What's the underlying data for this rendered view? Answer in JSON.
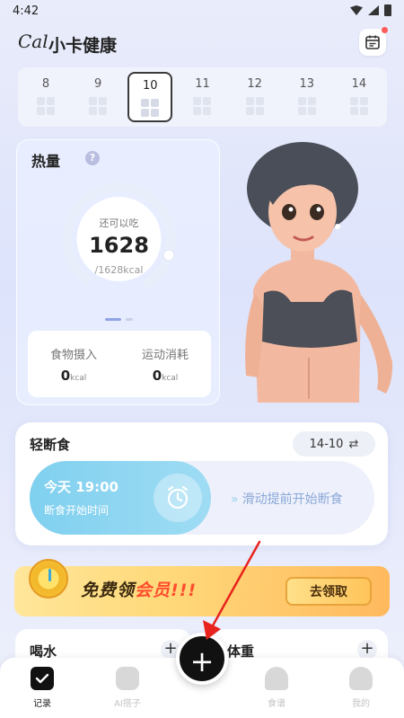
{
  "status_bar": {
    "time": "4:42"
  },
  "header": {
    "logo_text": "Cal",
    "title": "小卡健康"
  },
  "dates": [
    {
      "label": "8",
      "active": false
    },
    {
      "label": "9",
      "active": false
    },
    {
      "label": "10",
      "active": true
    },
    {
      "label": "11",
      "active": false
    },
    {
      "label": "12",
      "active": false
    },
    {
      "label": "13",
      "active": false
    },
    {
      "label": "14",
      "active": false
    }
  ],
  "calorie": {
    "title": "热量",
    "help": "?",
    "remaining_label": "还可以吃",
    "remaining_value": "1628",
    "target": "/1628kcal",
    "progress": 0,
    "food_label": "食物摄入",
    "food_value": "0",
    "exercise_label": "运动消耗",
    "exercise_value": "0",
    "unit": "kcal"
  },
  "fasting": {
    "title": "轻断食",
    "plan": "14-10",
    "time": "今天 19:00",
    "sub": "断食开始时间",
    "hint": "滑动提前开始断食"
  },
  "vip": {
    "text_1": "免费领",
    "text_2": "会员",
    "text_3": "!!!",
    "button": "去领取"
  },
  "water": {
    "title": "喝水",
    "plus": "+"
  },
  "weight": {
    "title": "体重",
    "plus": "+"
  },
  "tabs": [
    {
      "label": "记录",
      "active": true
    },
    {
      "label": "AI搭子",
      "active": false
    },
    {
      "label": "食谱",
      "active": false
    },
    {
      "label": "我的",
      "active": false
    }
  ],
  "fab": "+",
  "colors": {
    "accent": "#7fd0ef",
    "vip_red": "#ff4d2e",
    "annotation_arrow": "#e8231d"
  }
}
